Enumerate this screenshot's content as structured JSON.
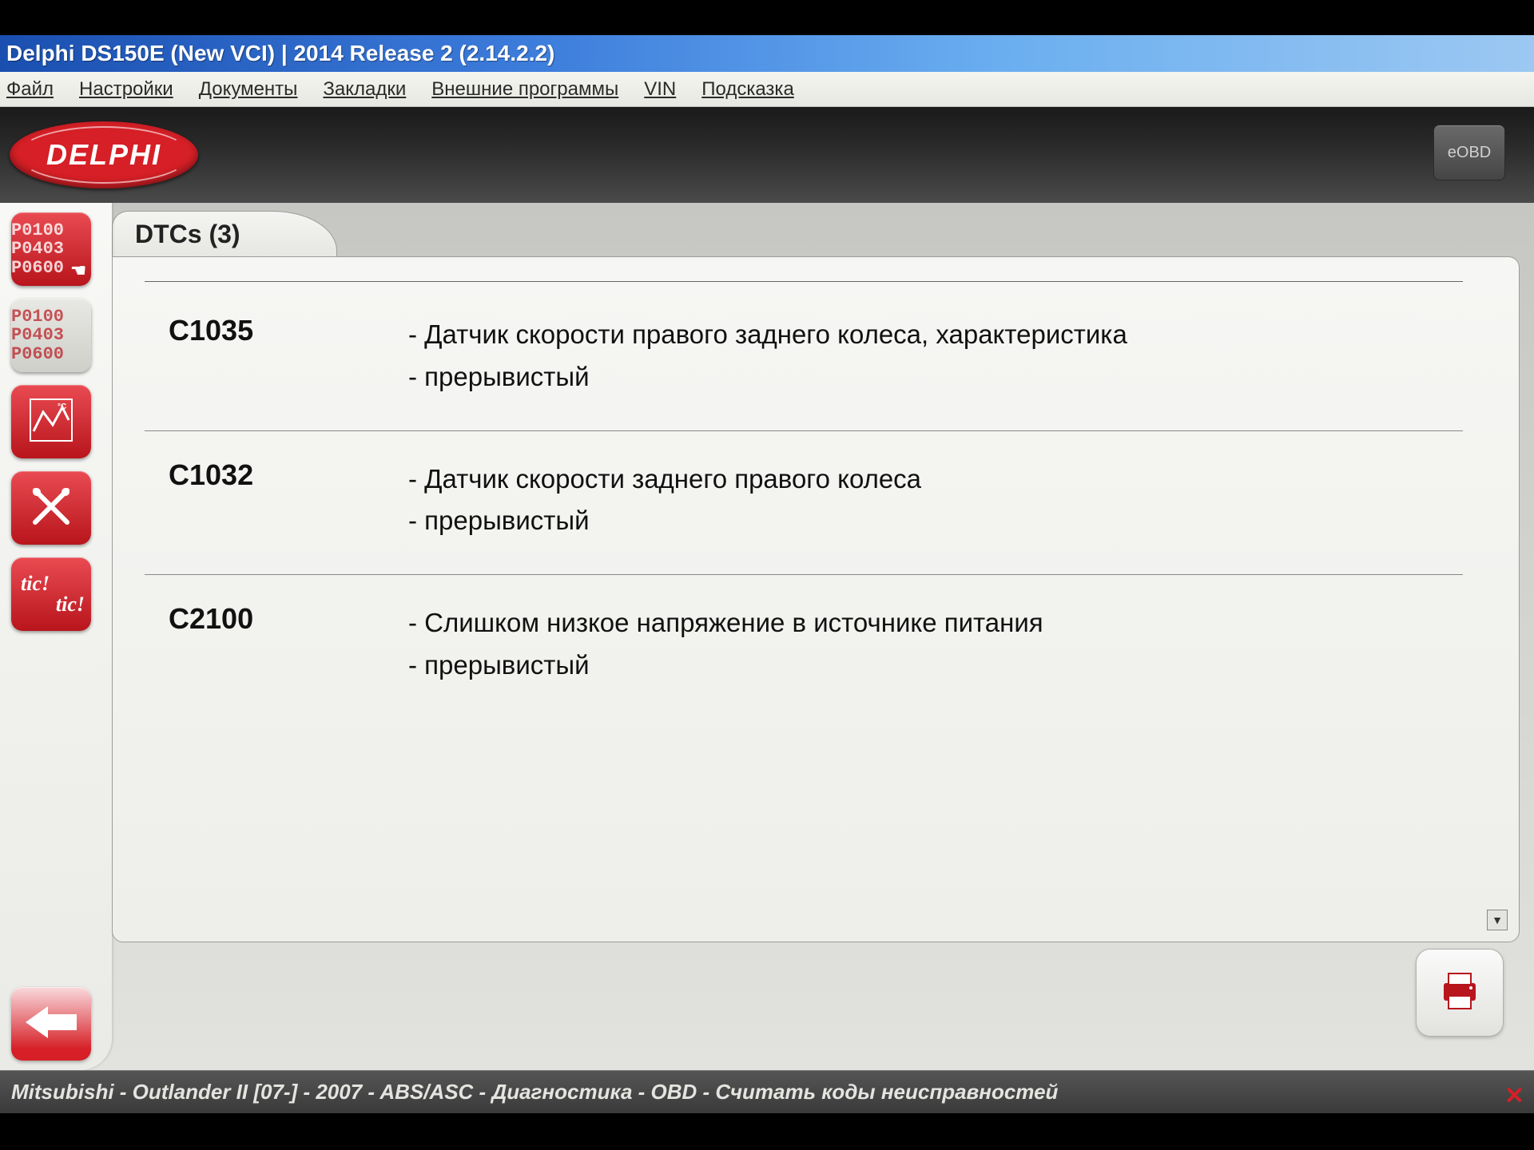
{
  "window": {
    "title": "Delphi DS150E (New VCI) | 2014 Release 2 (2.14.2.2)"
  },
  "menu": {
    "file": "Файл",
    "settings": "Настройки",
    "documents": "Документы",
    "bookmarks": "Закладки",
    "external": "Внешние программы",
    "vin": "VIN",
    "hint": "Подсказка"
  },
  "brand": {
    "logo_text": "DELPHI",
    "eobd": "eOBD"
  },
  "sidebar": {
    "codes1": "P0100 P0403 P0600",
    "codes2": "P0100 P0403 P0600",
    "tic1": "tic!",
    "tic2": "tic!"
  },
  "tab": {
    "label": "DTCs (3)"
  },
  "dtcs": [
    {
      "code": "C1035",
      "line1": "- Датчик скорости правого заднего колеса, характеристика",
      "line2": "- прерывистый"
    },
    {
      "code": "C1032",
      "line1": "- Датчик скорости заднего правого колеса",
      "line2": "- прерывистый"
    },
    {
      "code": "C2100",
      "line1": "- Слишком низкое напряжение в источнике питания",
      "line2": "- прерывистый"
    }
  ],
  "status": {
    "text": "Mitsubishi - Outlander II [07-] - 2007 - ABS/ASC - Диагностика - OBD - Считать коды неисправностей"
  }
}
